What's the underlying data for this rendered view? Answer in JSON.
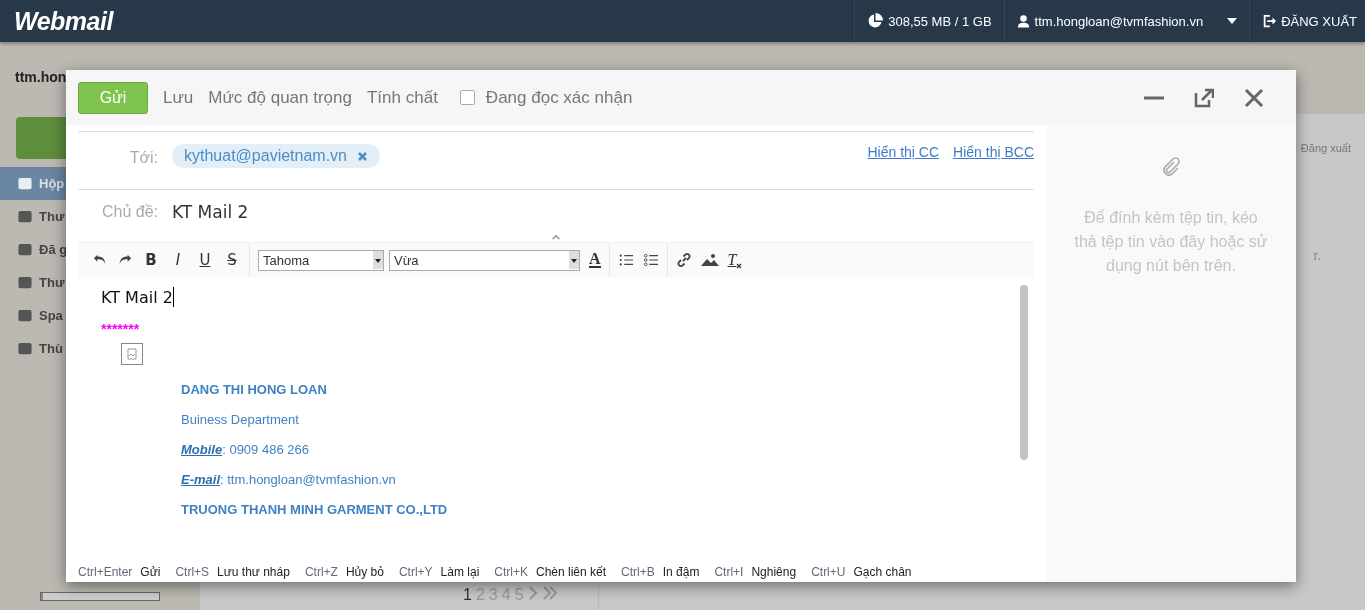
{
  "header": {
    "logo": "Webmail",
    "storage": "308,55 MB / 1 GB",
    "user": "ttm.hongloan@tvmfashion.vn",
    "logout": "ĐĂNG XUẤT"
  },
  "background": {
    "account": "ttm.hon",
    "sidebar_items": [
      {
        "label": "Hộp",
        "selected": true
      },
      {
        "label": "Thư",
        "selected": false
      },
      {
        "label": "Đã g",
        "selected": false
      },
      {
        "label": "Thư",
        "selected": false
      },
      {
        "label": "Spa",
        "selected": false
      },
      {
        "label": "Thù",
        "selected": false
      }
    ],
    "storage_bar": {
      "level": 0.02
    },
    "logout_link": "Đăng xuất",
    "content_fragment": "r.",
    "pages": [
      {
        "label": "1",
        "selected": true
      },
      {
        "label": "2",
        "selected": false
      },
      {
        "label": "3",
        "selected": false
      },
      {
        "label": "4",
        "selected": false
      },
      {
        "label": "5",
        "selected": false
      }
    ]
  },
  "compose": {
    "toolbar": {
      "send": "Gửi",
      "save": "Lưu",
      "importance": "Mức độ quan trọng",
      "properties": "Tính chất",
      "read_receipt": {
        "label": "Đang đọc xác nhận",
        "checked": false
      }
    },
    "to_label": "Tới:",
    "recipients": [
      "kythuat@pavietnam.vn"
    ],
    "show_cc": "Hiển thị CC",
    "show_bcc": "Hiển thị BCC",
    "subject_label": "Chủ đề:",
    "subject": "KT Mail 2",
    "editor_toolbar": {
      "format_buttons": [
        "B",
        "I",
        "U",
        "S"
      ],
      "font": "Tahoma",
      "size": "Vừa",
      "font_color_glyph": "A",
      "clear_format_glyph": "T"
    },
    "body": {
      "first_line": "KT Mail 2",
      "stars": "*******",
      "signature": [
        {
          "kind": "name",
          "text": "DANG THI HONG LOAN"
        },
        {
          "kind": "text",
          "text": "Buiness Department"
        },
        {
          "kind": "field",
          "label": "Mobile",
          "text": ": 0909 486 266"
        },
        {
          "kind": "field",
          "label": "E-mail",
          "text": ": ttm.hongloan@tvmfashion.vn"
        },
        {
          "kind": "name",
          "text": "TRUONG THANH MINH GARMENT CO.,LTD"
        }
      ]
    },
    "shortcuts": [
      {
        "key": "Ctrl+Enter",
        "action": "Gửi"
      },
      {
        "key": "Ctrl+S",
        "action": "Lưu thư nháp"
      },
      {
        "key": "Ctrl+Z",
        "action": "Hủy bỏ"
      },
      {
        "key": "Ctrl+Y",
        "action": "Làm lại"
      },
      {
        "key": "Ctrl+K",
        "action": "Chèn liên kết"
      },
      {
        "key": "Ctrl+B",
        "action": "In đậm"
      },
      {
        "key": "Ctrl+I",
        "action": "Nghiêng"
      },
      {
        "key": "Ctrl+U",
        "action": "Gạch chân"
      }
    ],
    "attach_hint": "Để đính kèm tệp tin, kéo thả tệp tin vào đây hoặc sử dụng nút bên trên."
  }
}
